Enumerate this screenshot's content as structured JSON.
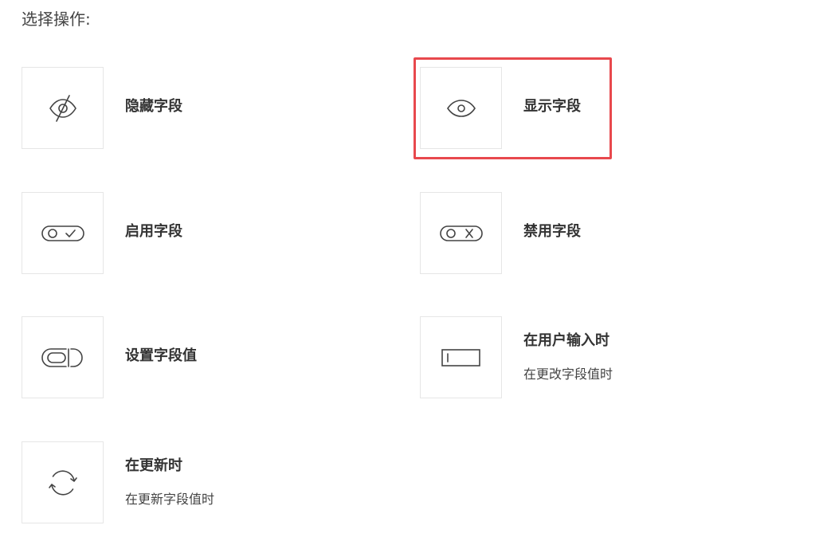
{
  "heading": "选择操作:",
  "highlight_color": "#e8484d",
  "actions": [
    {
      "title": "隐藏字段",
      "icon": "eye-slash-icon"
    },
    {
      "title": "显示字段",
      "icon": "eye-icon"
    },
    {
      "title": "启用字段",
      "icon": "toggle-check-icon"
    },
    {
      "title": "禁用字段",
      "icon": "toggle-x-icon"
    },
    {
      "title": "设置字段值",
      "icon": "field-value-icon"
    },
    {
      "title": "在用户输入时",
      "subtitle": "在更改字段值时",
      "icon": "text-input-icon"
    },
    {
      "title": "在更新时",
      "subtitle": "在更新字段值时",
      "icon": "refresh-icon"
    }
  ]
}
